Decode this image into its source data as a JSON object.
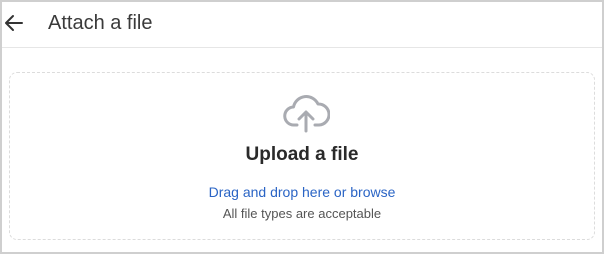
{
  "header": {
    "title": "Attach a file",
    "back_icon": "arrow-left-icon"
  },
  "dropzone": {
    "icon": "cloud-upload-icon",
    "title": "Upload a file",
    "action_text": "Drag and drop here or browse",
    "note": "All file types are acceptable"
  },
  "colors": {
    "link": "#2a64c5",
    "icon": "#a9abb1",
    "title": "#2a2a2a",
    "border": "#dcdcdc"
  }
}
